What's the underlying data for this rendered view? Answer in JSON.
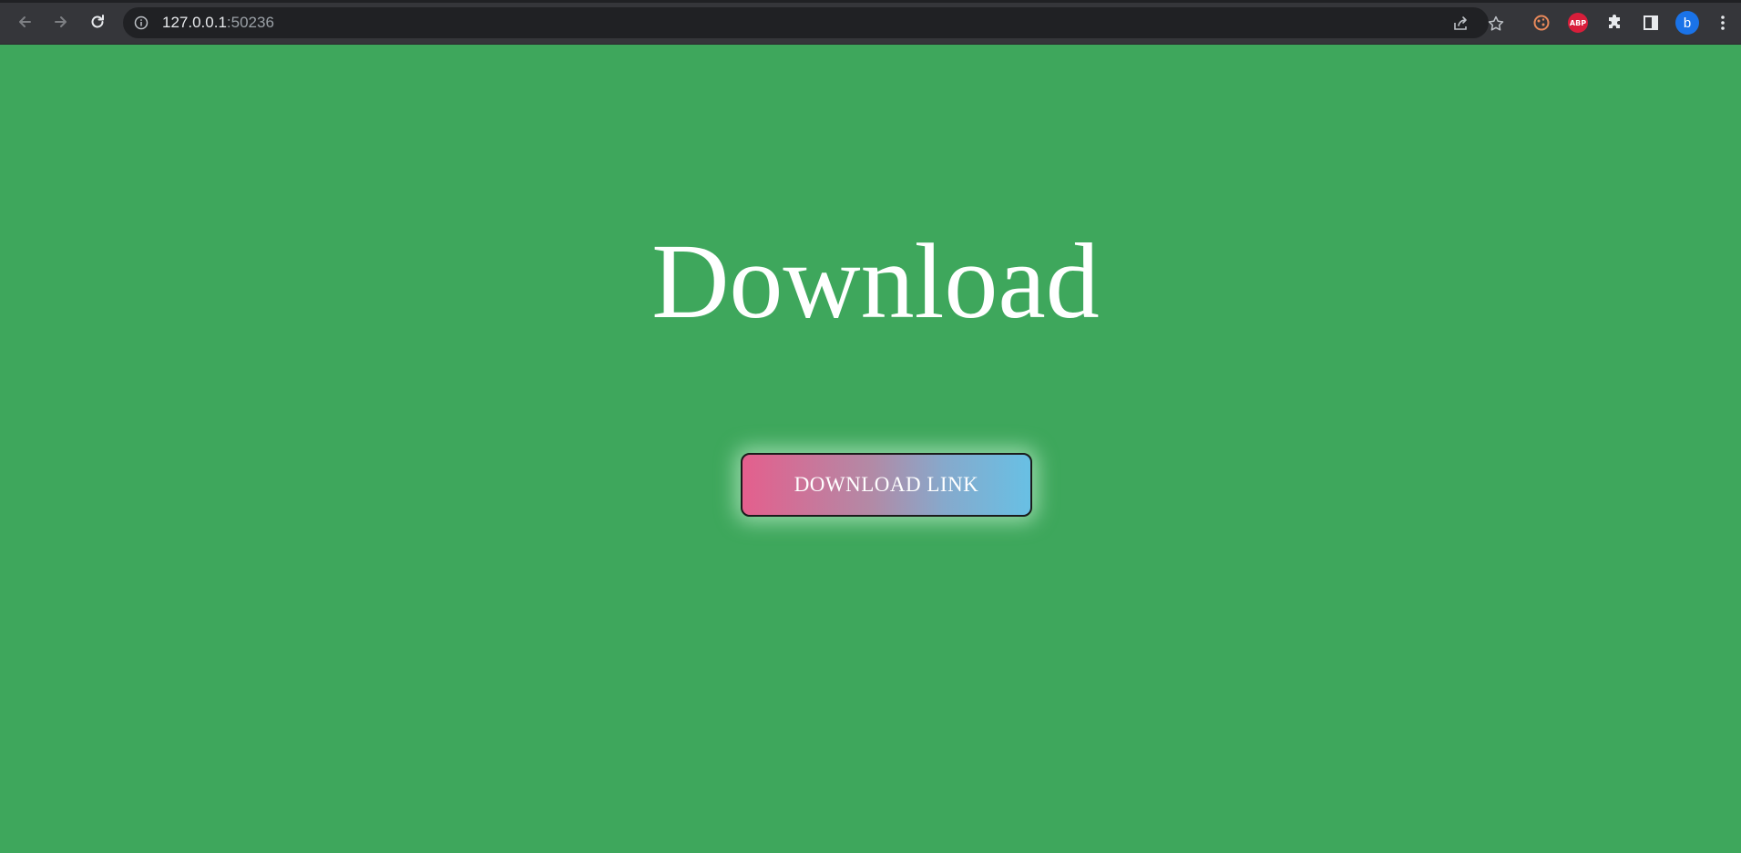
{
  "browser": {
    "url_host": "127.0.0.1",
    "url_port": ":50236",
    "buttons": {
      "back_icon": "arrow-left-icon",
      "forward_icon": "arrow-right-icon",
      "reload_icon": "reload-icon",
      "site_info_icon": "info-icon",
      "share_icon": "share-icon",
      "bookmark_icon": "star-icon",
      "extension_1_icon": "cookie-extension-icon",
      "extension_2_label": "ABP",
      "extensions_icon": "puzzle-icon",
      "side_panel_icon": "side-panel-icon",
      "profile_initial": "b",
      "menu_icon": "kebab-menu-icon"
    }
  },
  "page": {
    "heading": "Download",
    "button_label": "DOWNLOAD LINK",
    "colors": {
      "background": "#3ea75c",
      "heading": "#ffffff",
      "button_gradient_start": "#e45f8d",
      "button_gradient_end": "#68c0e4"
    }
  }
}
